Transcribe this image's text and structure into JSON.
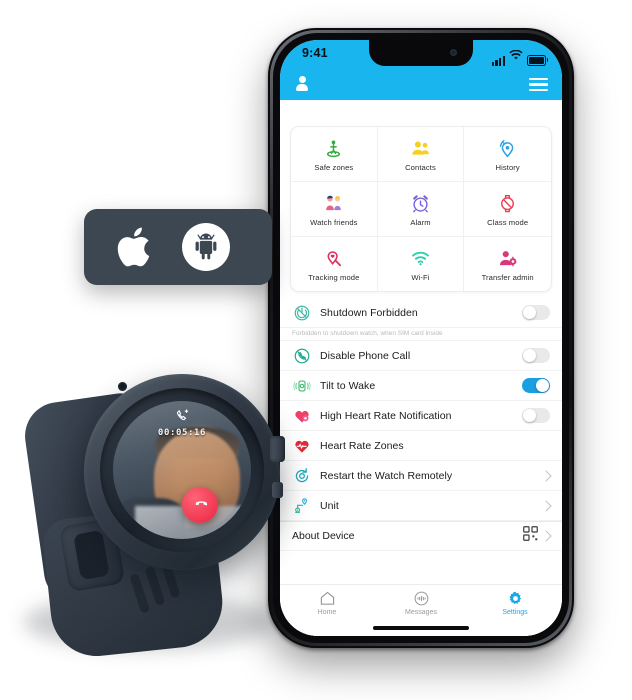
{
  "phone": {
    "status_bar": {
      "time": "9:41",
      "signal_icon": "cellular-bars-icon",
      "wifi_icon": "wifi-icon",
      "battery_icon": "battery-icon"
    },
    "app_bar": {
      "profile_icon": "person-icon",
      "menu_icon": "hamburger-menu-icon"
    },
    "grid": [
      {
        "label": "Safe zones",
        "icon": "safe-zone-icon",
        "color": "#2fae3e"
      },
      {
        "label": "Contacts",
        "icon": "contacts-icon",
        "color": "#f7cf1d"
      },
      {
        "label": "History",
        "icon": "history-location-icon",
        "color": "#2aa3e8"
      },
      {
        "label": "Watch friends",
        "icon": "watch-friends-icon",
        "color": "#e8618c"
      },
      {
        "label": "Alarm",
        "icon": "alarm-clock-icon",
        "color": "#7b5fe0"
      },
      {
        "label": "Class mode",
        "icon": "class-mode-icon",
        "color": "#e8404f"
      },
      {
        "label": "Tracking mode",
        "icon": "tracking-mode-icon",
        "color": "#e02a5a"
      },
      {
        "label": "Wi-Fi",
        "icon": "wifi-icon",
        "color": "#2ecfb0"
      },
      {
        "label": "Transfer admin",
        "icon": "transfer-admin-icon",
        "color": "#d9377e"
      }
    ],
    "settings": [
      {
        "label": "Shutdown Forbidden",
        "icon": "power-off-forbidden-icon",
        "type": "toggle",
        "state": "off",
        "subtitle": "Forbidden to shutdown watch, when SIM card inside"
      },
      {
        "label": "Disable Phone Call",
        "icon": "phone-disabled-icon",
        "type": "toggle",
        "state": "off"
      },
      {
        "label": "Tilt to Wake",
        "icon": "tilt-to-wake-icon",
        "type": "toggle",
        "state": "on"
      },
      {
        "label": "High Heart Rate Notification",
        "icon": "heart-alert-icon",
        "type": "toggle",
        "state": "off"
      },
      {
        "label": "Heart Rate Zones",
        "icon": "heart-pulse-icon",
        "type": "plain"
      },
      {
        "label": "Restart the Watch Remotely",
        "icon": "restart-icon",
        "type": "chevron"
      },
      {
        "label": "Unit",
        "icon": "unit-icon",
        "type": "chevron"
      }
    ],
    "about": {
      "label": "About Device",
      "icon": "qr-code-icon"
    },
    "tabs": [
      {
        "label": "Home",
        "icon": "home-icon",
        "active": false
      },
      {
        "label": "Messages",
        "icon": "messages-icon",
        "active": false
      },
      {
        "label": "Settings",
        "icon": "gear-icon",
        "active": true
      }
    ]
  },
  "os_badge": {
    "apple_icon": "apple-logo-icon",
    "android_icon": "android-robot-icon",
    "background": "#3d4751"
  },
  "watch": {
    "call_timer": "00:05:16",
    "call_icon": "video-call-icon",
    "end_call_icon": "end-call-icon",
    "accent": "#e8243f"
  },
  "theme": {
    "brand_blue": "#19b5ee",
    "toggle_on": "#1a9fe0",
    "tab_active": "#19a8e8",
    "page_bg": "#ffffff"
  }
}
